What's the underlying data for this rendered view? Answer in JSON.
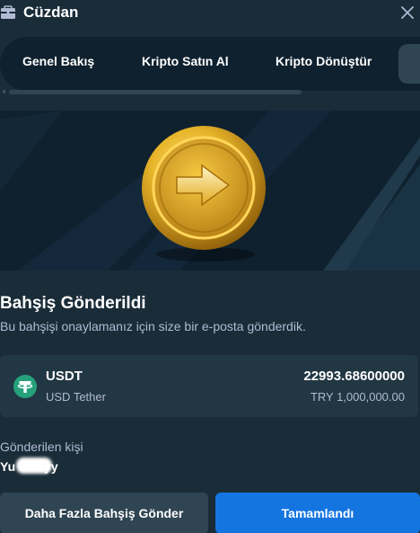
{
  "header": {
    "title": "Cüzdan"
  },
  "tabs": [
    {
      "label": "Genel Bakış"
    },
    {
      "label": "Kripto Satın Al"
    },
    {
      "label": "Kripto Dönüştür"
    }
  ],
  "confirmation": {
    "heading": "Bahşiş Gönderildi",
    "message": "Bu bahşişi onaylamanız için size bir e-posta gönderdik."
  },
  "currency": {
    "code": "USDT",
    "name": "USD Tether",
    "amount": "22993.68600000",
    "fiat_value": "TRY 1,000,000.00",
    "icon": "tether-icon"
  },
  "recipient": {
    "label": "Gönderilen kişi",
    "name_prefix": "Yu",
    "name_suffix": "yy"
  },
  "buttons": {
    "send_more": "Daha Fazla Bahşiş Gönder",
    "done": "Tamamlandı"
  },
  "colors": {
    "background": "#1a2c38",
    "tab_bar": "#0f212e",
    "card": "#213743",
    "secondary_button": "#2f4553",
    "primary_button": "#1475e1",
    "muted_text": "#b1bad3",
    "tether_green": "#26a17b",
    "coin_gold": "#e8b52a"
  }
}
